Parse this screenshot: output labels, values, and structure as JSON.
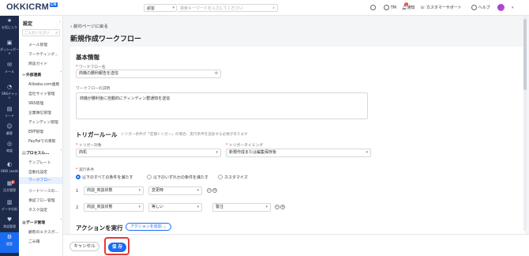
{
  "topbar": {
    "logo_main": "OKKICRM",
    "logo_badge": "CN",
    "scope_select": "顧客",
    "search_placeholder": "検索キーワードを入力してください",
    "tm_label": "TM",
    "notify_label": "通知",
    "notify_count": "1",
    "support_label": "カスタマーサポート",
    "help_label": "ヘルプ"
  },
  "leftnav": {
    "items": [
      {
        "label": "お気に入り",
        "icon": "star-icon"
      },
      {
        "label": "ダッシュボード",
        "icon": "dashboard-icon"
      },
      {
        "label": "メール",
        "icon": "mail-icon"
      },
      {
        "label": "SNSチャット",
        "icon": "chat-icon"
      },
      {
        "label": "リード",
        "icon": "lead-icon"
      },
      {
        "label": "顧客",
        "icon": "customer-icon"
      },
      {
        "label": "商談",
        "icon": "deal-icon"
      },
      {
        "label": "OKKI Leads",
        "icon": "leads-icon"
      },
      {
        "label": "注文管理",
        "icon": "order-icon"
      },
      {
        "label": "データ分析",
        "icon": "analytics-icon"
      },
      {
        "label": "承認管理",
        "icon": "approval-icon"
      },
      {
        "label": "設定",
        "icon": "settings-icon"
      }
    ],
    "badge_order": "8"
  },
  "subnav": {
    "title": "設定",
    "search_placeholder": "ご入力ください",
    "items_top": [
      "メール管理",
      "マーケティング...",
      "商談ガイド"
    ],
    "sec_external": "外部連携",
    "items_external": [
      "Alibaba.com連携",
      "自社サイト管理",
      "SNS管理",
      "企業微信管理",
      "ディンディン管理",
      "ERP管理",
      "PayPalでの受取"
    ],
    "sec_process": "プロセスル...",
    "items_process": [
      "テンプレート",
      "自動化設定",
      "ワークフロー",
      "リードソースの...",
      "承認フロー管理",
      "タスク設定"
    ],
    "sec_data": "データ管理",
    "items_data": [
      "顧客のエクスポ...",
      "ごみ箱"
    ]
  },
  "main": {
    "back_label": "前のページに戻る",
    "page_title": "新規作成ワークフロー",
    "basic_title": "基本情報",
    "name_label": "ワークフロー名",
    "name_value": "商機の勝利報告を送信",
    "desc_label": "ワークフローの説明",
    "desc_value": "商機が勝利後に自動的にディンディン群通知を送信",
    "trigger_title": "トリガールール",
    "trigger_hint": "トリガー条件が「定期トリガー」の場合、実行条件を追加する必要があります",
    "target_label": "トリガー対象",
    "target_value": "商机",
    "timing_label": "トリガータイミング",
    "timing_value": "新規作成または編集保存後",
    "cond_label": "実行条件",
    "radio_all": "以下のすべての条件を満たす",
    "radio_any": "以下のいずれかの条件を満たす",
    "radio_custom": "カスタマイズ",
    "cond_rows": [
      {
        "num": "1",
        "field": "商談_商談状態",
        "op": "変更時",
        "value": ""
      },
      {
        "num": "2",
        "field": "商談_商談状態",
        "op": "等しい",
        "value": "警注"
      }
    ],
    "action_title": "アクションを実行",
    "action_add": "アクションを追加"
  },
  "footer": {
    "cancel_label": "キャンセル",
    "save_label": "保 存"
  }
}
